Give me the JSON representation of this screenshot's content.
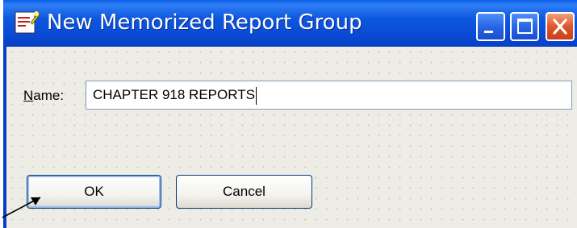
{
  "window": {
    "title": "New Memorized Report Group",
    "icon": "memorized-report-icon",
    "controls": {
      "minimize": "minimize-icon",
      "maximize": "maximize-icon",
      "close": "close-icon"
    }
  },
  "form": {
    "name_label_access_key": "N",
    "name_label_rest": "ame:",
    "name_value": "CHAPTER 918 REPORTS"
  },
  "buttons": {
    "ok_label": "OK",
    "cancel_label": "Cancel"
  },
  "colors": {
    "titlebar": "#0a4ad4",
    "client": "#eeede5",
    "close": "#e0552a"
  }
}
